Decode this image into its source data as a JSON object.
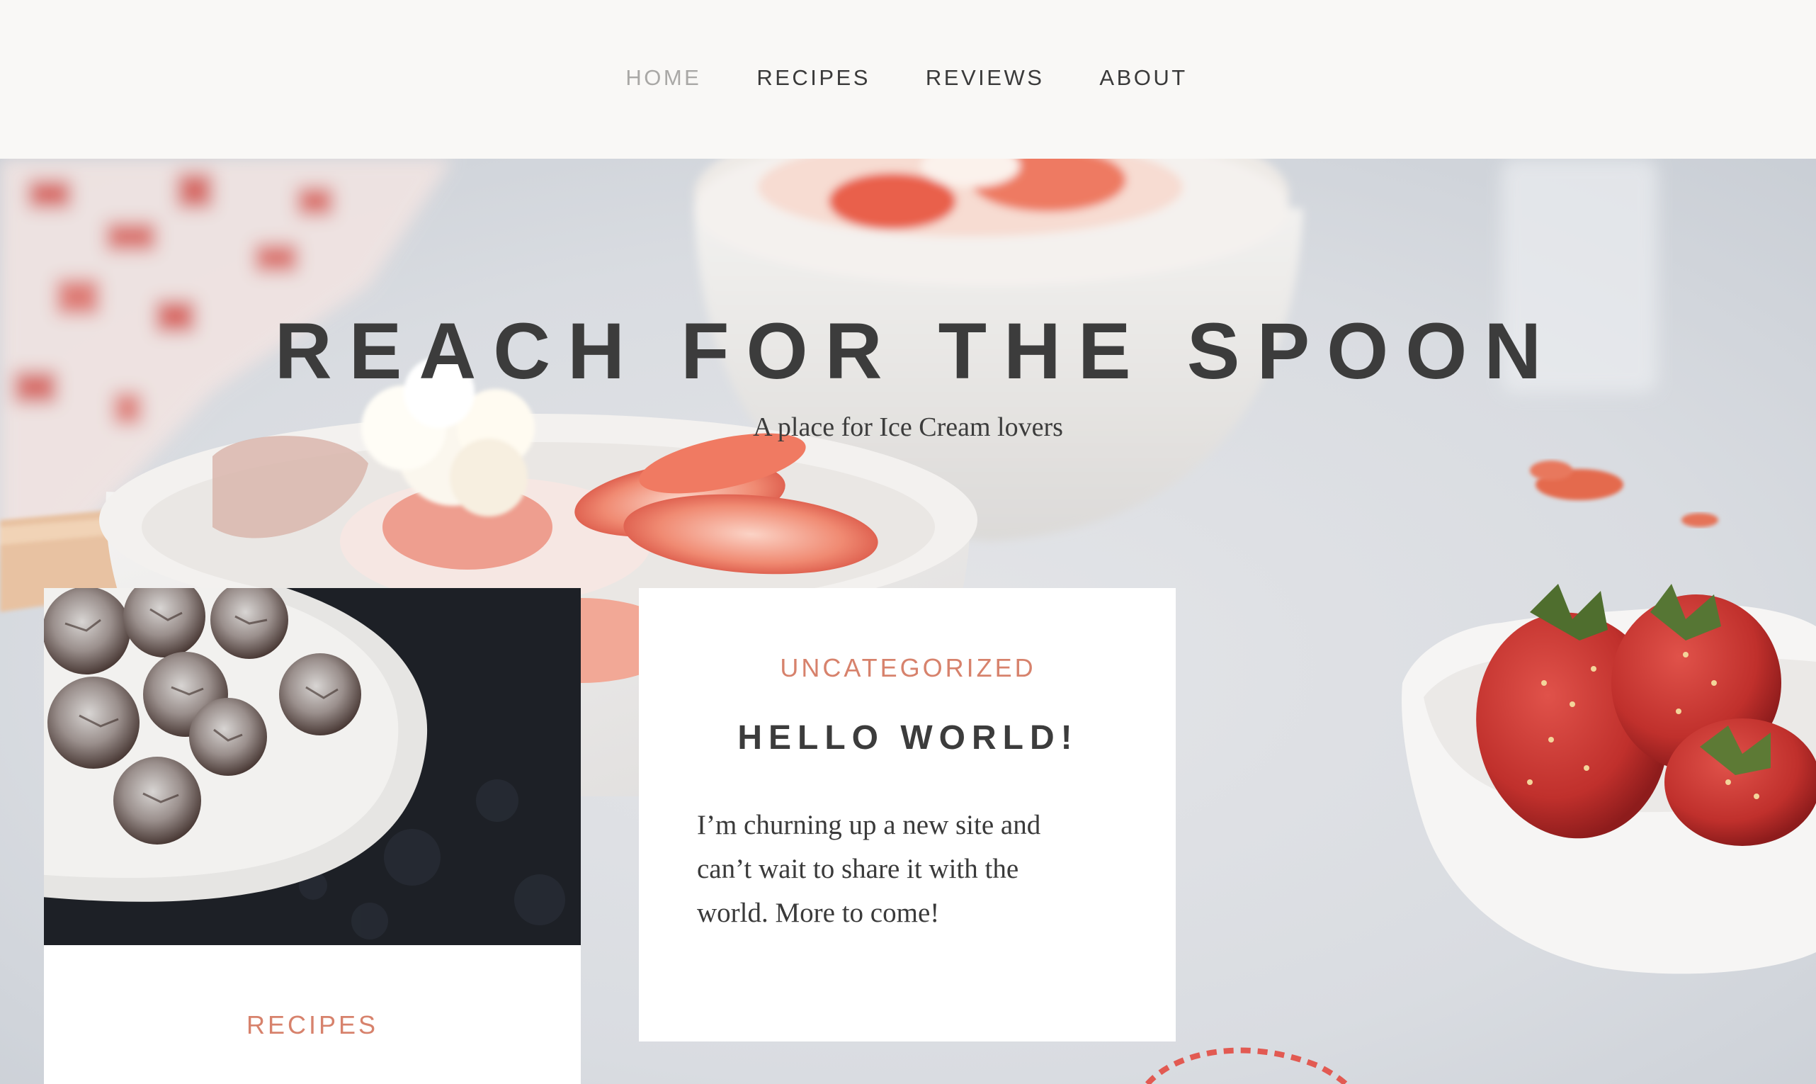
{
  "nav": {
    "items": [
      {
        "label": "HOME",
        "current": true
      },
      {
        "label": "RECIPES",
        "current": false
      },
      {
        "label": "REVIEWS",
        "current": false
      },
      {
        "label": "ABOUT",
        "current": false
      }
    ]
  },
  "hero": {
    "title": "REACH FOR THE SPOON",
    "tagline": "A place for Ice Cream lovers"
  },
  "posts": [
    {
      "category": "RECIPES",
      "thumbnail": "crinkle-cookies-on-plate"
    },
    {
      "category": "UNCATEGORIZED",
      "title": "HELLO WORLD!",
      "excerpt": "I’m churning up a new site and can’t wait to share it with the world. More to come!"
    }
  ],
  "colors": {
    "header_bg": "#f9f8f6",
    "nav_text": "#3a3a3a",
    "nav_current": "#a9a8a6",
    "accent": "#d7826c",
    "title_text": "#3c3c3c",
    "card_bg": "#ffffff"
  }
}
